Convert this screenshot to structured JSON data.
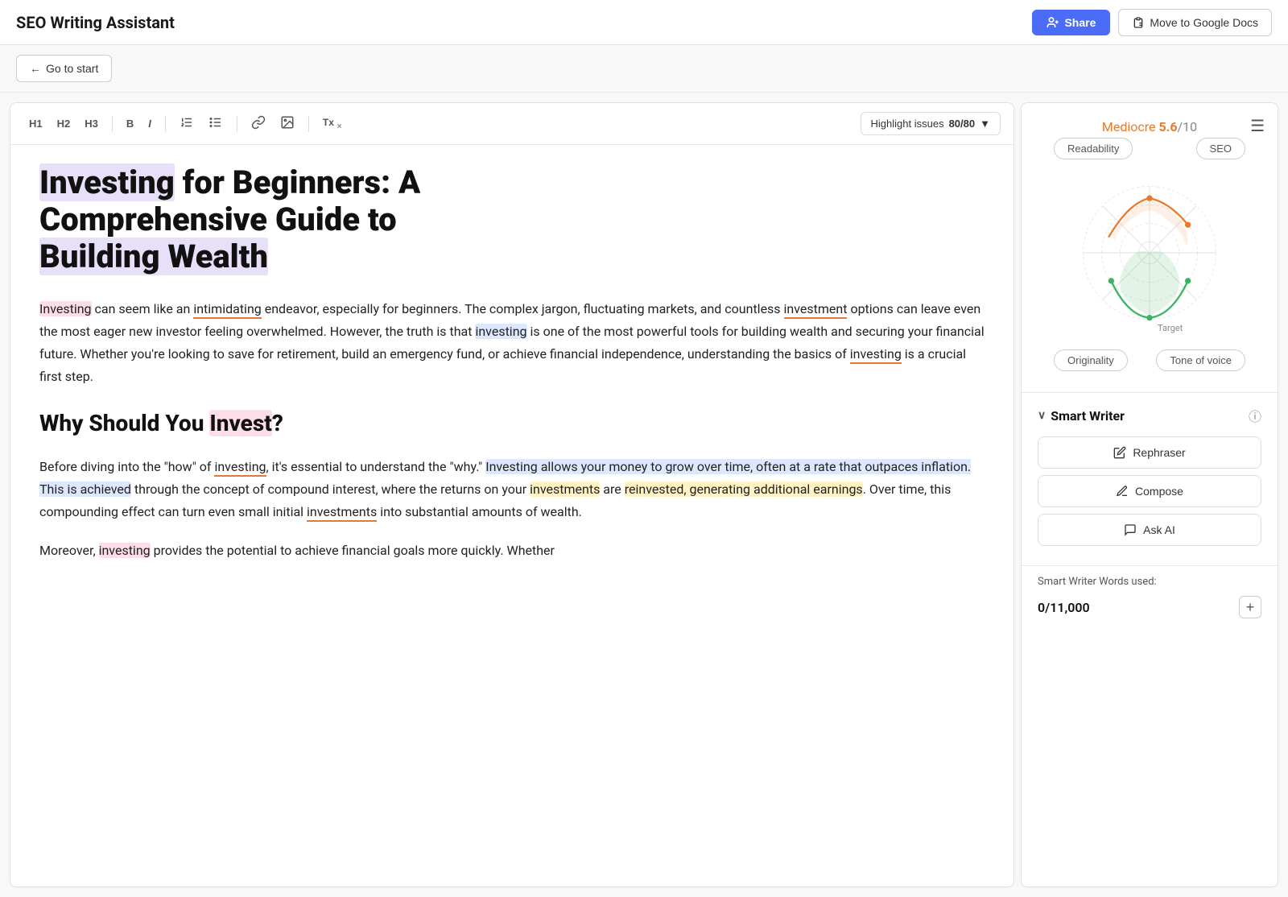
{
  "header": {
    "title": "SEO Writing Assistant",
    "share_label": "Share",
    "google_docs_label": "Move to Google Docs"
  },
  "subheader": {
    "go_start_label": "Go to start"
  },
  "toolbar": {
    "h1": "H1",
    "h2": "H2",
    "h3": "H3",
    "bold": "B",
    "italic": "I",
    "ol": "OL",
    "ul": "UL",
    "link": "🔗",
    "image": "🖼",
    "clear": "Tx",
    "highlight_label": "Highlight issues",
    "word_count": "80/80",
    "dropdown_arrow": "▼"
  },
  "article": {
    "title": "Investing for Beginners: A Comprehensive Guide to Building Wealth",
    "para1": "Investing can seem like an intimidating endeavor, especially for beginners. The complex jargon, fluctuating markets, and countless investment options can leave even the most eager new investor feeling overwhelmed. However, the truth is that investing is one of the most powerful tools for building wealth and securing your financial future. Whether you're looking to save for retirement, build an emergency fund, or achieve financial independence, understanding the basics of investing is a crucial first step.",
    "h2_1": "Why Should You Invest?",
    "para2": "Before diving into the \"how\" of investing, it's essential to understand the \"why.\" Investing allows your money to grow over time, often at a rate that outpaces inflation. This is achieved through the concept of compound interest, where the returns on your investments are reinvested, generating additional earnings. Over time, this compounding effect can turn even small initial investments into substantial amounts of wealth.",
    "para3": "Moreover, investing provides the potential to achieve financial goals more quickly. Whether"
  },
  "score": {
    "label": "Mediocre",
    "value": "5.6",
    "out_of": "/10"
  },
  "tabs": {
    "readability": "Readability",
    "seo": "SEO",
    "originality": "Originality",
    "tone_of_voice": "Tone of voice"
  },
  "chart": {
    "target_label": "Target"
  },
  "smart_writer": {
    "title": "Smart Writer",
    "rephraser_label": "Rephraser",
    "compose_label": "Compose",
    "ask_ai_label": "Ask AI",
    "words_used_label": "Smart Writer Words used:",
    "words_count": "0/11,000",
    "add_button": "+"
  }
}
